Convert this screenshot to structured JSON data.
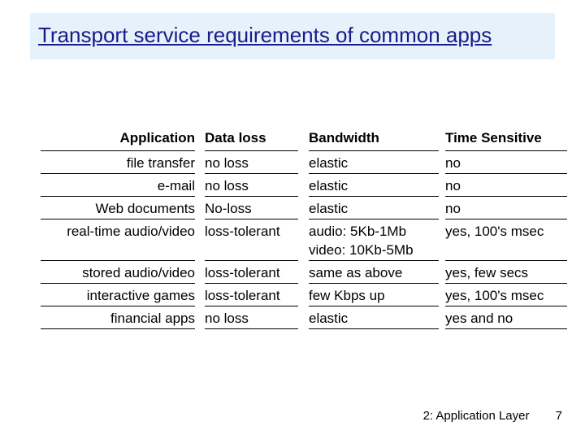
{
  "title": "Transport service requirements of common apps",
  "headers": {
    "app": "Application",
    "loss": "Data loss",
    "bw": "Bandwidth",
    "time": "Time Sensitive"
  },
  "rows": {
    "r0": {
      "app": "file transfer",
      "loss": "no loss",
      "bw": "elastic",
      "time": "no"
    },
    "r1": {
      "app": "e-mail",
      "loss": "no loss",
      "bw": "elastic",
      "time": "no"
    },
    "r2": {
      "app": "Web documents",
      "loss": "No-loss",
      "bw": "elastic",
      "time": "no"
    },
    "r3": {
      "app": "real-time audio/video",
      "loss": "loss-tolerant",
      "bw": "audio: 5Kb-1Mb",
      "time": "yes, 100's msec"
    },
    "r3b": {
      "bw2": "video: 10Kb-5Mb"
    },
    "r4": {
      "app": "stored audio/video",
      "loss": "loss-tolerant",
      "bw": "same as above",
      "time": "yes, few secs"
    },
    "r5": {
      "app": "interactive games",
      "loss": "loss-tolerant",
      "bw": "few Kbps up",
      "time": "yes, 100's msec"
    },
    "r6": {
      "app": "financial apps",
      "loss": "no loss",
      "bw": "elastic",
      "time": "yes and no"
    }
  },
  "footer": {
    "chapter": "2: Application Layer",
    "page": "7"
  }
}
